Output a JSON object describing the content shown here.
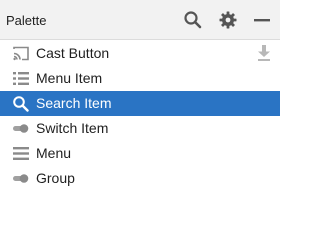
{
  "palette": {
    "title": "Palette",
    "header_icons": [
      "search-icon",
      "gear-icon",
      "minimize-icon"
    ]
  },
  "items": [
    {
      "label": "Cast Button",
      "icon": "cast-icon",
      "trailing_icon": "download-icon"
    },
    {
      "label": "Menu Item",
      "icon": "menu-item-icon"
    },
    {
      "label": "Search Item",
      "icon": "search-icon",
      "selected": true
    },
    {
      "label": "Switch Item",
      "icon": "switch-icon"
    },
    {
      "label": "Menu",
      "icon": "menu-icon"
    },
    {
      "label": "Group",
      "icon": "group-icon"
    }
  ],
  "colors": {
    "selection": "#2a74c4",
    "header_bg": "#f2f2f2",
    "icon": "#8a8a8a",
    "header_icon": "#555555"
  }
}
